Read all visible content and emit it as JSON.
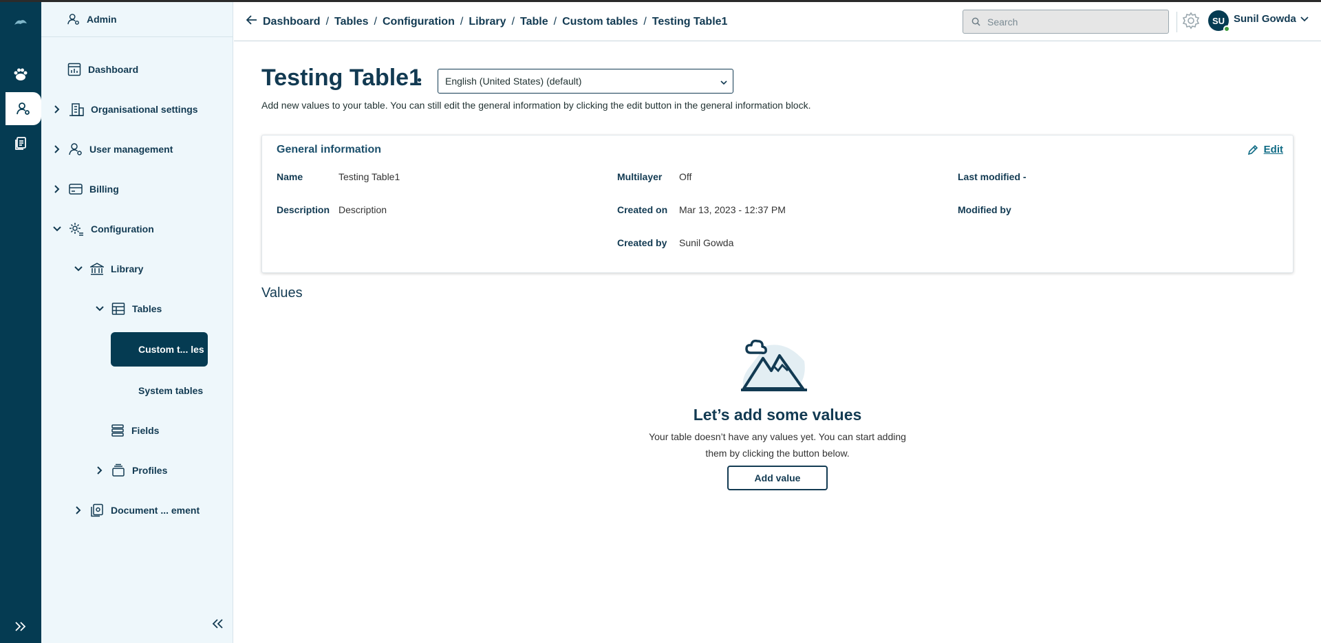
{
  "sidebar": {
    "header": "Admin",
    "items": [
      {
        "label": "Dashboard"
      },
      {
        "label": "Organisational settings"
      },
      {
        "label": "User management"
      },
      {
        "label": "Billing"
      },
      {
        "label": "Configuration"
      },
      {
        "label": "Library"
      },
      {
        "label": "Tables"
      },
      {
        "label": "Custom t... les"
      },
      {
        "label": "System tables"
      },
      {
        "label": "Fields"
      },
      {
        "label": "Profiles"
      },
      {
        "label": "Document ... ement"
      }
    ]
  },
  "breadcrumb": [
    "Dashboard",
    "Tables",
    "Configuration",
    "Library",
    "Table",
    "Custom tables",
    "Testing Table1"
  ],
  "search": {
    "placeholder": "Search"
  },
  "user": {
    "initials": "SU",
    "name": "Sunil Gowda"
  },
  "page": {
    "title": "Testing Table1",
    "language": "English (United States) (default)",
    "subtitle": "Add new values to your table. You can still edit the general information by clicking the edit button in the general information block."
  },
  "general": {
    "title": "General information",
    "edit_label": "Edit",
    "name_label": "Name",
    "name_value": "Testing Table1",
    "desc_label": "Description",
    "desc_value": "Description",
    "multilayer_label": "Multilayer",
    "multilayer_value": "Off",
    "created_on_label": "Created on",
    "created_on_value": "Mar 13, 2023 - 12:37 PM",
    "created_by_label": "Created by",
    "created_by_value": "Sunil Gowda",
    "last_modified_label": "Last modified -",
    "modified_by_label": "Modified by"
  },
  "values": {
    "heading": "Values",
    "empty_title": "Let’s add some values",
    "empty_text": "Your table doesn’t have any values yet. You can start adding them by clicking the button below.",
    "add_label": "Add value"
  },
  "colors": {
    "primary": "#053b52",
    "link": "#0f6b85",
    "sidebar_bg": "#eef7fb"
  }
}
